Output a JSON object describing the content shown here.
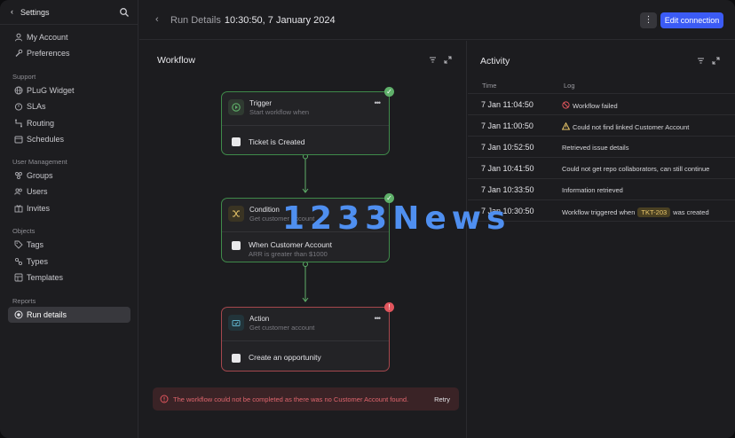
{
  "sidebar": {
    "title": "Settings",
    "account_items": [
      {
        "label": "My Account",
        "icon": "person-icon"
      },
      {
        "label": "Preferences",
        "icon": "wrench-icon"
      }
    ],
    "sections": [
      {
        "title": "Support",
        "items": [
          {
            "label": "PLuG Widget",
            "icon": "globe-icon"
          },
          {
            "label": "SLAs",
            "icon": "timer-icon"
          },
          {
            "label": "Routing",
            "icon": "routing-icon"
          },
          {
            "label": "Schedules",
            "icon": "calendar-icon"
          }
        ]
      },
      {
        "title": "User Management",
        "items": [
          {
            "label": "Groups",
            "icon": "groups-icon"
          },
          {
            "label": "Users",
            "icon": "users-icon"
          },
          {
            "label": "Invites",
            "icon": "invite-icon"
          }
        ]
      },
      {
        "title": "Objects",
        "items": [
          {
            "label": "Tags",
            "icon": "tag-icon"
          },
          {
            "label": "Types",
            "icon": "types-icon"
          },
          {
            "label": "Templates",
            "icon": "templates-icon"
          }
        ]
      },
      {
        "title": "Reports",
        "items": [
          {
            "label": "Run details",
            "icon": "run-details-icon",
            "active": true
          }
        ]
      }
    ]
  },
  "header": {
    "breadcrumb": "Run Details",
    "timestamp": "10:30:50, 7 January 2024",
    "more_label": "⋮",
    "edit_label": "Edit connection"
  },
  "workflow": {
    "title": "Workflow",
    "nodes": [
      {
        "title": "Trigger",
        "subtitle": "Start workflow when",
        "body": "Ticket is Created",
        "body_sub": "",
        "status": "success"
      },
      {
        "title": "Condition",
        "subtitle": "Get customer account",
        "body": "When Customer Account",
        "body_sub": "ARR is greater than $1000",
        "status": "success"
      },
      {
        "title": "Action",
        "subtitle": "Get customer account",
        "body": "Create an opportunity",
        "body_sub": "",
        "status": "error"
      }
    ],
    "error_message": "The workflow could not be completed as there was no Customer Account found.",
    "retry_label": "Retry"
  },
  "activity": {
    "title": "Activity",
    "columns": [
      "Time",
      "Log"
    ],
    "rows": [
      {
        "time": "7 Jan 11:04:50",
        "log": "Workflow failed",
        "icon": "error-circle-icon"
      },
      {
        "time": "7 Jan 11:00:50",
        "log": "Could not find linked Customer Account",
        "icon": "warning-icon"
      },
      {
        "time": "7 Jan 10:52:50",
        "log": "Retrieved issue details",
        "icon": ""
      },
      {
        "time": "7 Jan 10:41:50",
        "log": "Could not get repo collaborators, can still continue",
        "icon": ""
      },
      {
        "time": "7 Jan 10:33:50",
        "log": "Information retrieved",
        "icon": ""
      },
      {
        "time": "7 Jan 10:30:50",
        "log_prefix": "Workflow triggered when",
        "chip": "TKT-203",
        "log_suffix": "was created",
        "icon": ""
      }
    ]
  },
  "watermark": "1233News",
  "colors": {
    "accent": "#3b5bf5",
    "success": "#5fb06a",
    "error": "#e0555d",
    "warning": "#e9c66a"
  }
}
